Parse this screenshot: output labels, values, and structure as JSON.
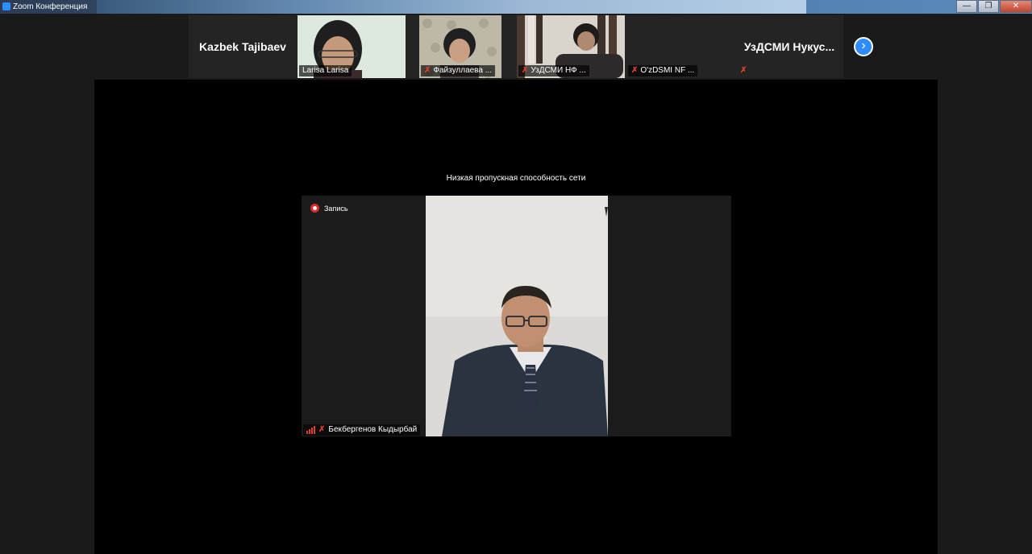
{
  "window": {
    "title": "Zoom Конференция"
  },
  "strip": {
    "participants": [
      {
        "name": "Kazbek Tajibaev",
        "type": "name-only"
      },
      {
        "label": "Larisa Larisa",
        "type": "video",
        "muted": false
      },
      {
        "label": "Файзуллаева ...",
        "type": "video",
        "muted": true
      },
      {
        "label": "УзДСМИ НФ ...",
        "type": "video",
        "muted": true
      },
      {
        "label": "O'zDSMI NF ...",
        "type": "muted-label",
        "muted": true
      },
      {
        "name": "УзДСМИ  Нукус...",
        "type": "name-only",
        "muted": true
      }
    ]
  },
  "stage": {
    "notice": "Низкая пропускная способность сети",
    "recording_label": "Запись",
    "speaker_name": "Бекбергенов Кыдырбай"
  },
  "icons": {
    "mic_muted": "mic-muted-icon",
    "next": "chevron-right-icon",
    "record": "record-icon",
    "signal": "signal-bars-icon"
  },
  "colors": {
    "accent": "#2d8cff",
    "muted_red": "#e0402a",
    "stage_bg": "#000000",
    "app_bg": "#1a1a1a"
  }
}
